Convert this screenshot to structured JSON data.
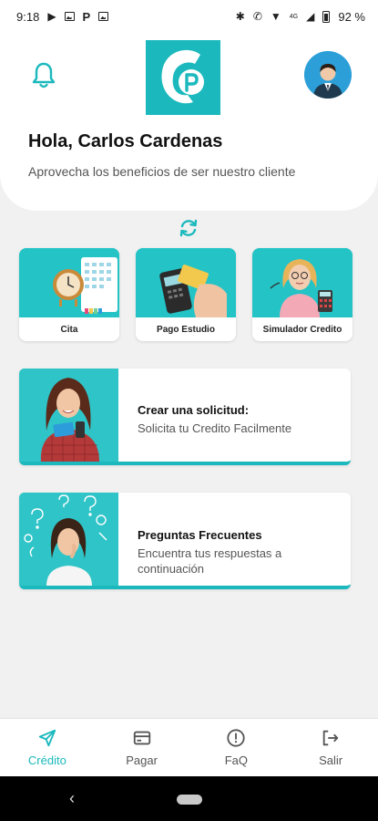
{
  "status_bar": {
    "time": "9:18",
    "battery": "92 %",
    "signal_label": "4G"
  },
  "header": {
    "greeting": "Hola, Carlos Cardenas",
    "subtitle": "Aprovecha los beneficios de ser nuestro cliente"
  },
  "tiles": [
    {
      "label": "Cita",
      "icon": "calendar-clock"
    },
    {
      "label": "Pago Estudio",
      "icon": "card-terminal"
    },
    {
      "label": "Simulador Credito",
      "icon": "calculator"
    }
  ],
  "cards": [
    {
      "title": "Crear una solicitud:",
      "subtitle": "Solicita tu Credito Facilmente"
    },
    {
      "title": "Preguntas Frecuentes",
      "subtitle": "Encuentra tus respuestas a continuación"
    }
  ],
  "bottom_nav": [
    {
      "label": "Crédito",
      "icon": "send-icon",
      "active": true
    },
    {
      "label": "Pagar",
      "icon": "card-icon",
      "active": false
    },
    {
      "label": "FaQ",
      "icon": "alert-icon",
      "active": false
    },
    {
      "label": "Salir",
      "icon": "logout-icon",
      "active": false
    }
  ],
  "colors": {
    "accent": "#1bb9bd",
    "background": "#f1f1f1",
    "card": "#ffffff"
  }
}
